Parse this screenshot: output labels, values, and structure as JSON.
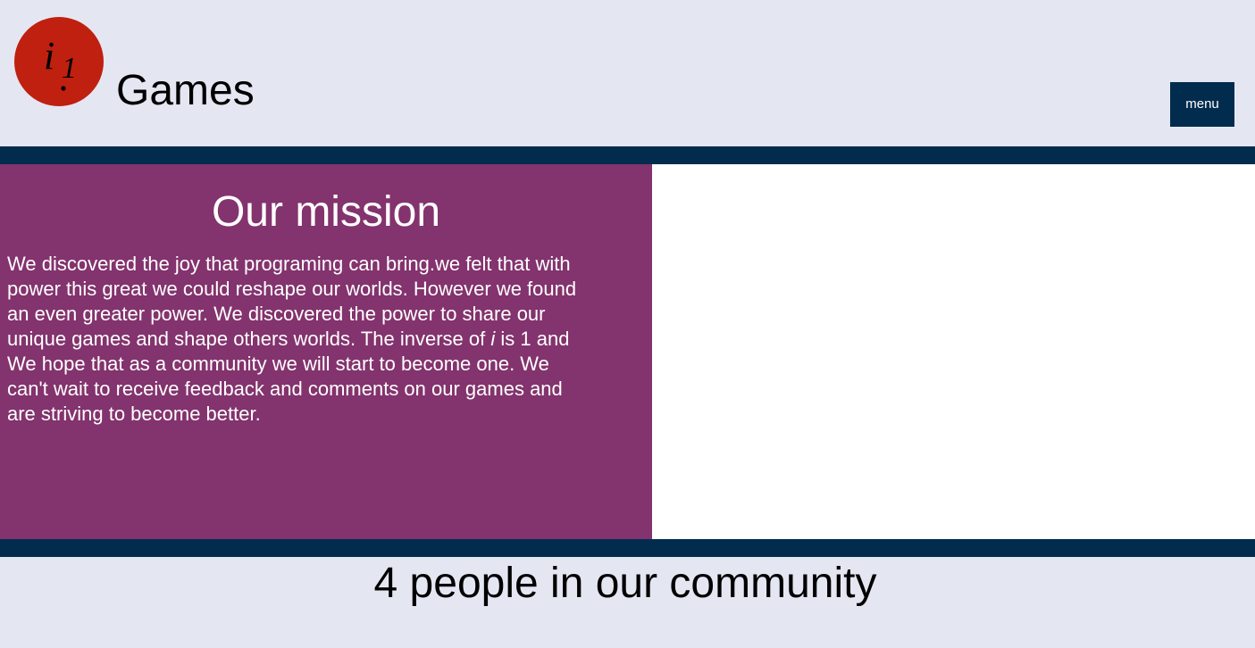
{
  "header": {
    "logo_text": "i1",
    "title": "Games",
    "menu_label": "menu"
  },
  "mission": {
    "title": "Our mission",
    "text_before_i": "We discovered the joy that programing can bring.we felt that with\npower this great we could reshape our worlds. However we found\nan even greater power. We discovered the power to share our\nunique games and shape others worlds. The inverse of ",
    "italic_i": "i",
    "text_after_i": " is 1 and\nWe hope that as a community we will start to become one. We\ncan't wait to receive feedback and comments on our games and\nare striving to become better."
  },
  "community": {
    "text": "4 people in our community"
  },
  "colors": {
    "background": "#e4e7f2",
    "navy": "#022c4e",
    "purple": "#83336d",
    "logo_red": "#c0200f"
  }
}
